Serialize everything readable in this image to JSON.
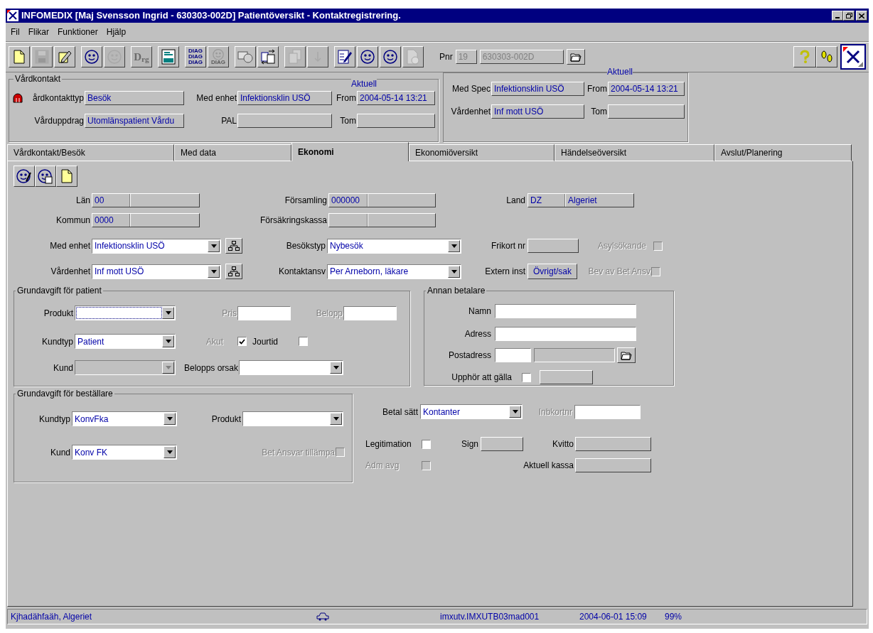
{
  "window": {
    "title": "INFOMEDIX [Maj Svensson Ingrid - 630303-002D] Patientöversikt - Kontaktregistrering."
  },
  "menu": [
    {
      "label": "Fil"
    },
    {
      "label": "Flikar"
    },
    {
      "label": "Funktioner"
    },
    {
      "label": "Hjälp"
    }
  ],
  "toolbar": [
    {
      "kind": "new",
      "disabled": false
    },
    {
      "kind": "save",
      "disabled": true
    },
    {
      "kind": "edit",
      "disabled": false
    },
    {
      "kind": "person",
      "disabled": false
    },
    {
      "kind": "person",
      "disabled": true
    },
    {
      "kind": "drg",
      "label": "D$_{rg}$",
      "disabled": true
    },
    {
      "kind": "screen",
      "disabled": false
    },
    {
      "kind": "diag",
      "lines": [
        "DIAG",
        "DIAG",
        "DIAG"
      ],
      "disabled": false
    },
    {
      "kind": "face-diag",
      "label": "DIAG",
      "disabled": true
    },
    {
      "kind": "card",
      "disabled": false
    },
    {
      "kind": "transfer",
      "disabled": false
    },
    {
      "kind": "copy",
      "disabled": true
    },
    {
      "kind": "down",
      "disabled": true
    },
    {
      "kind": "form",
      "disabled": false
    },
    {
      "kind": "face",
      "disabled": false
    },
    {
      "kind": "face",
      "disabled": false
    },
    {
      "kind": "doc-clock",
      "disabled": true
    }
  ],
  "pnr": {
    "label": "Pnr",
    "century": "19",
    "number": "630303-002D",
    "disabled": true
  },
  "vardkontakt": {
    "title": "Vårdkontakt",
    "aktuell": "Aktuell",
    "fields": [
      {
        "label": "årdkontakttyp",
        "value": "Besök"
      },
      {
        "label": "Med enhet",
        "value": "Infektionsklin USÖ"
      },
      {
        "label": "From",
        "value": "2004-05-14 13:21"
      },
      {
        "label": "Vårduppdrag",
        "value": "Utomlänspatient Vårdu"
      },
      {
        "label": "PAL"
      },
      {
        "label": "Tom"
      }
    ]
  },
  "spec": {
    "aktuell": "Aktuell",
    "fields": [
      {
        "label": "Med Spec",
        "value": "Infektionsklin USÖ"
      },
      {
        "label": "From",
        "value": "2004-05-14 13:21"
      },
      {
        "label": "Vårdenhet",
        "value": "Inf mott USÖ"
      },
      {
        "label": "Tom"
      }
    ]
  },
  "tabs": [
    {
      "label": "Vårdkontakt/Besök",
      "selected": false
    },
    {
      "label": "Med data",
      "selected": false
    },
    {
      "label": "Ekonomi",
      "selected": true
    },
    {
      "label": "Ekonomiöversikt",
      "selected": false
    },
    {
      "label": "Händelseöversikt",
      "selected": false
    },
    {
      "label": "Avslut/Planering",
      "selected": false
    }
  ],
  "ekonomi": {
    "toolbar": [
      {
        "kind": "person-edit"
      },
      {
        "kind": "person-doc"
      },
      {
        "kind": "new"
      }
    ],
    "lan": {
      "label": "Län",
      "code": "00"
    },
    "forsamling": {
      "label": "Församling",
      "code": "000000"
    },
    "land": {
      "label": "Land",
      "code": "DZ",
      "name": "Algeriet"
    },
    "kommun": {
      "label": "Kommun",
      "code": "0000"
    },
    "forsakringskassa": {
      "label": "Försäkringskassa"
    },
    "med_enhet": {
      "label": "Med enhet",
      "value": "Infektionsklin USÖ"
    },
    "besokstyp": {
      "label": "Besökstyp",
      "value": "Nybesök"
    },
    "frikort_nr": {
      "label": "Frikort nr"
    },
    "asylsokande": {
      "label": "Asylsökande",
      "checked": false,
      "disabled": true
    },
    "vardenhet": {
      "label": "Vårdenhet",
      "value": "Inf mott USÖ"
    },
    "kontaktansv": {
      "label": "Kontaktansv",
      "value": "Per Arneborn, läkare"
    },
    "extern_inst": {
      "label": "Extern inst",
      "value": "Övrigt/sak"
    },
    "bev_av_bet_ansv": {
      "label": "Bev av Bet Ansv",
      "checked": false,
      "disabled": true
    },
    "patient": {
      "title": "Grundavgift för patient",
      "produkt": {
        "label": "Produkt",
        "focused": true,
        "disabled": false
      },
      "pris": {
        "label": "Pris",
        "label_disabled": true
      },
      "belopp": {
        "label": "Belopp",
        "label_disabled": true
      },
      "kundtyp": {
        "label": "Kundtyp",
        "value": "Patient",
        "disabled": false
      },
      "akut": {
        "label": "Akut",
        "checked": true,
        "disabled": false,
        "label_disabled": true
      },
      "jourtid": {
        "label": "Jourtid",
        "checked": false,
        "disabled": false
      },
      "kund": {
        "label": "Kund",
        "disabled": true
      },
      "belopps_orsak": {
        "label": "Belopps orsak",
        "disabled": false
      }
    },
    "annan": {
      "title": "Annan betalare",
      "namn": {
        "label": "Namn"
      },
      "adress": {
        "label": "Adress"
      },
      "postadress": {
        "label": "Postadress"
      },
      "upphor": {
        "label": "Upphör att gälla",
        "checked": false,
        "disabled": false
      }
    },
    "bestallare": {
      "title": "Grundavgift för beställare",
      "kundtyp": {
        "label": "Kundtyp",
        "value": "KonvFka",
        "disabled": false
      },
      "produkt": {
        "label": "Produkt",
        "disabled": false
      },
      "kund": {
        "label": "Kund",
        "value": "Konv FK",
        "disabled": false
      },
      "bet_ansvar": {
        "label": "Bet Ansvar tillämpa",
        "checked": false,
        "disabled": true
      }
    },
    "betal_satt": {
      "label": "Betal sätt",
      "value": "Kontanter",
      "disabled": false
    },
    "inbkortnr": {
      "label": "Inbkortnr",
      "label_disabled": true
    },
    "legitimation": {
      "label": "Legitimation",
      "checked": false,
      "disabled": false
    },
    "sign": {
      "label": "Sign"
    },
    "kvitto": {
      "label": "Kvitto"
    },
    "adm_avg": {
      "label": "Adm avg",
      "checked": false,
      "disabled": true
    },
    "aktuell_kassa": {
      "label": "Aktuell kassa"
    }
  },
  "status_bar": {
    "location": "Kjhadähfaäh, Algeriet",
    "server": "imxutv.IMXUTB03mad001",
    "datetime": "2004-06-01 15:09",
    "zoom": "99%"
  }
}
